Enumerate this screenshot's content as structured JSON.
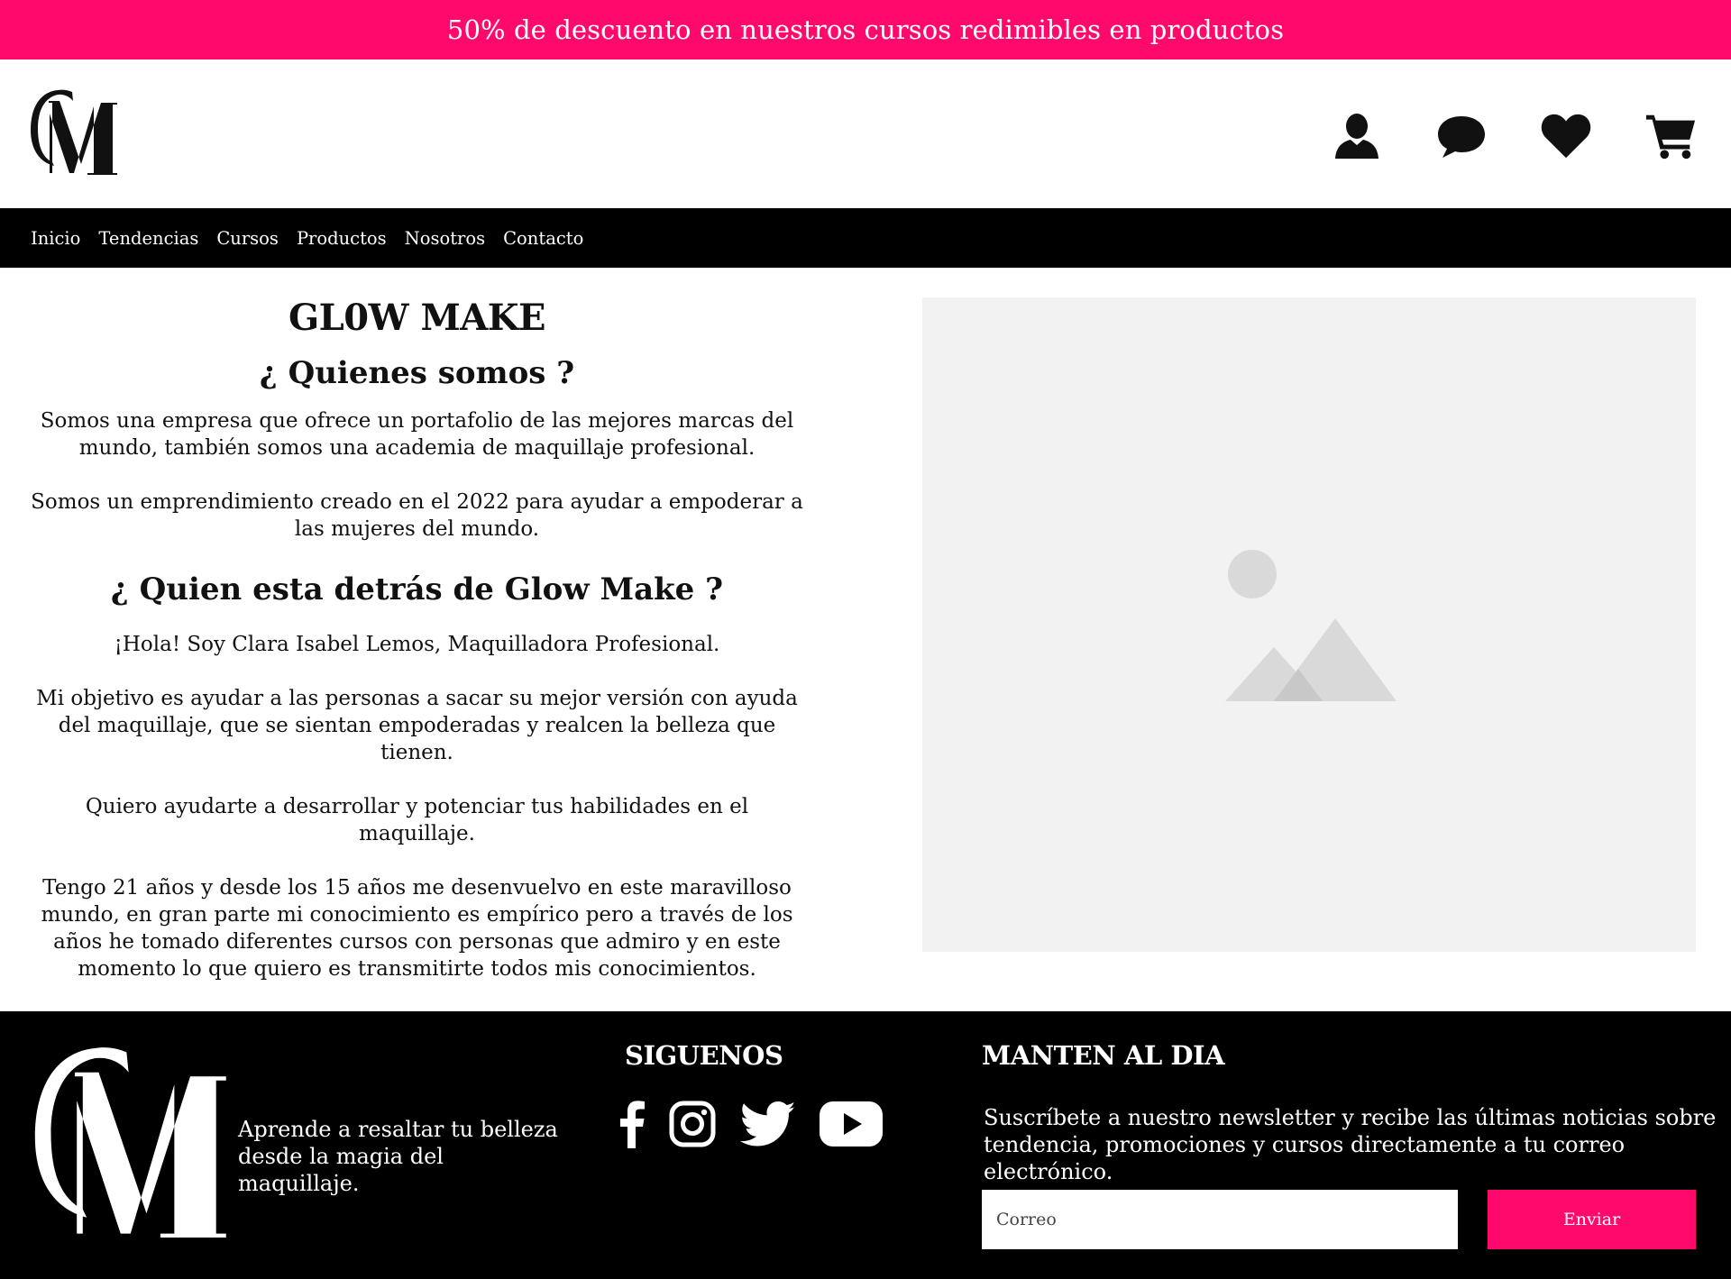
{
  "promo": {
    "text": "50% de descuento en nuestros cursos redimibles en productos"
  },
  "colors": {
    "accent": "#ff0a6c",
    "dark": "#000000",
    "placeholder_bg": "#f2f2f2"
  },
  "header": {
    "logo_icon": "gm-monogram-logo",
    "icons": [
      "user-icon",
      "chat-icon",
      "heart-icon",
      "cart-icon"
    ]
  },
  "nav": {
    "items": [
      {
        "label": "Inicio"
      },
      {
        "label": "Tendencias"
      },
      {
        "label": "Cursos"
      },
      {
        "label": "Productos"
      },
      {
        "label": "Nosotros"
      },
      {
        "label": "Contacto"
      }
    ]
  },
  "about": {
    "brand": "GL0W MAKE",
    "heading1": "¿ Quienes somos ?",
    "p1": "Somos una empresa que ofrece un portafolio de las mejores marcas del mundo, también somos una academia de maquillaje profesional.",
    "p2": "Somos un emprendimiento creado en el 2022 para ayudar a empoderar a las mujeres del mundo.",
    "heading2": "¿ Quien esta detrás de Glow Make ?",
    "p3": "¡Hola! Soy Clara Isabel Lemos, Maquilladora Profesional.",
    "p4": "Mi objetivo es ayudar a las personas a sacar su mejor versión con ayuda del maquillaje, que se sientan empoderadas y realcen la belleza que tienen.",
    "p5": "Quiero ayudarte a desarrollar y potenciar tus habilidades en el maquillaje.",
    "p6": "Tengo 21 años y desde los 15 años me desenvuelvo en este maravilloso mundo, en gran parte mi conocimiento es empírico pero a través de los años he tomado diferentes cursos con personas que admiro y en este momento lo que quiero es transmitirte todos mis conocimientos.",
    "image_icon": "image-placeholder-icon"
  },
  "footer": {
    "tagline": "Aprende a resaltar tu belleza desde la magia del maquillaje.",
    "follow_title": "SIGUENOS",
    "social_icons": [
      "facebook-icon",
      "instagram-icon",
      "twitter-icon",
      "youtube-icon"
    ],
    "keep_title": "MANTEN AL DIA",
    "newsletter_text": "Suscríbete a nuestro newsletter y recibe las últimas noticias sobre tendencia, promociones y cursos directamente a tu correo electrónico.",
    "email_placeholder": "Correo",
    "send_label": "Enviar"
  }
}
